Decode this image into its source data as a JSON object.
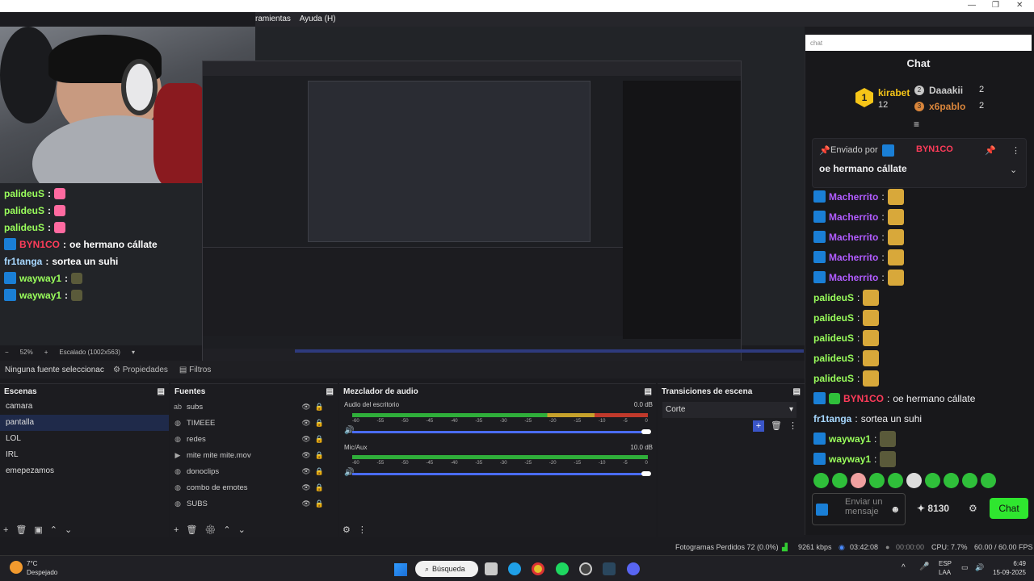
{
  "menu": {
    "item_tools": "ramientas",
    "item_help": "Ayuda (H)"
  },
  "window_controls": {
    "minimize": "—",
    "maximize": "❐",
    "close": "✕"
  },
  "overlay_chat": [
    {
      "name": "palideuS",
      "sep": ":",
      "text": ""
    },
    {
      "name": "palideuS",
      "sep": ":",
      "text": ""
    },
    {
      "name": "palideuS",
      "sep": ":",
      "text": ""
    },
    {
      "name": "BYN1CO",
      "sep": ":",
      "text": "oe hermano cállate"
    },
    {
      "name": "fr1tanga",
      "sep": ":",
      "text": "sortea un suhi"
    },
    {
      "name": "wayway1",
      "sep": ":",
      "text": ""
    },
    {
      "name": "wayway1",
      "sep": ":",
      "text": ""
    }
  ],
  "zoom": {
    "percent": "52%",
    "plus": "+",
    "scale": "Escalado (1002x563)"
  },
  "tabs": {
    "source": "Ninguna fuente seleccionac",
    "properties": "Propiedades",
    "filters": "Filtros"
  },
  "scenes": {
    "title": "Escenas",
    "items": [
      "camara",
      "pantalla",
      "LOL",
      "IRL",
      "emepezamos"
    ]
  },
  "sources": {
    "title": "Fuentes",
    "items": [
      {
        "icon": "ab",
        "label": "subs"
      },
      {
        "icon": "◍",
        "label": "TIMEEE"
      },
      {
        "icon": "◍",
        "label": "redes"
      },
      {
        "icon": "▶",
        "label": "mite mite mite.mov"
      },
      {
        "icon": "◍",
        "label": "donoclips"
      },
      {
        "icon": "◍",
        "label": "combo de emotes"
      },
      {
        "icon": "◍",
        "label": "SUBS"
      }
    ]
  },
  "mixer": {
    "title": "Mezclador de audio",
    "channels": [
      {
        "name": "Audio del escritorio",
        "db": "0.0 dB",
        "level": 0.6
      },
      {
        "name": "Mic/Aux",
        "db": "10.0 dB",
        "level": 0.6
      }
    ],
    "ticks": [
      "-60",
      "-55",
      "-50",
      "-45",
      "-40",
      "-35",
      "-30",
      "-25",
      "-20",
      "-15",
      "-10",
      "-5",
      "0"
    ]
  },
  "transitions": {
    "title": "Transiciones de escena",
    "selected": "Corte"
  },
  "status": {
    "dropped": "Fotogramas Perdidos 72 (0.0%)",
    "kbps": "9261 kbps",
    "live_time": "03:42:08",
    "rec_time": "00:00:00",
    "cpu": "CPU: 7.7%",
    "fps": "60.00 / 60.00 FPS"
  },
  "taskbar": {
    "weather_temp": "7°C",
    "weather_desc": "Despejado",
    "search": "Búsqueda",
    "lang1": "ESP",
    "lang2": "LAA",
    "time": "6:49",
    "date": "15-09-2025"
  },
  "chat": {
    "top_input": "chat",
    "heading": "Chat",
    "leaders": [
      {
        "rank": "1",
        "name": "kirabet",
        "count": "12"
      },
      {
        "rank": "2",
        "name": "Daaakii",
        "count": "2"
      },
      {
        "rank": "3",
        "name": "x6pablo",
        "count": "2"
      }
    ],
    "pinned_label": "Enviado por",
    "pinned_user": "BYN1CO",
    "pinned_text": "oe hermano cállate",
    "messages": [
      {
        "name": "Macherrito",
        "sep": ":",
        "text": "",
        "color": "purple"
      },
      {
        "name": "Macherrito",
        "sep": ":",
        "text": "",
        "color": "purple"
      },
      {
        "name": "Macherrito",
        "sep": ":",
        "text": "",
        "color": "purple"
      },
      {
        "name": "Macherrito",
        "sep": ":",
        "text": "",
        "color": "purple"
      },
      {
        "name": "Macherrito",
        "sep": ":",
        "text": "",
        "color": "purple"
      },
      {
        "name": "palideuS",
        "sep": ":",
        "text": "",
        "color": "green"
      },
      {
        "name": "palideuS",
        "sep": ":",
        "text": "",
        "color": "green"
      },
      {
        "name": "palideuS",
        "sep": ":",
        "text": "",
        "color": "green"
      },
      {
        "name": "palideuS",
        "sep": ":",
        "text": "",
        "color": "green"
      },
      {
        "name": "palideuS",
        "sep": ":",
        "text": "",
        "color": "green"
      },
      {
        "name": "BYN1CO",
        "sep": ":",
        "text": "oe hermano cállate",
        "color": "red"
      },
      {
        "name": "fr1tanga",
        "sep": ":",
        "text": "sortea un suhi",
        "color": "blue"
      },
      {
        "name": "wayway1",
        "sep": ":",
        "text": "",
        "color": "green"
      },
      {
        "name": "wayway1",
        "sep": ":",
        "text": "",
        "color": "green"
      }
    ],
    "send_placeholder": "Enviar un mensaje",
    "points": "8130",
    "chat_button": "Chat"
  }
}
